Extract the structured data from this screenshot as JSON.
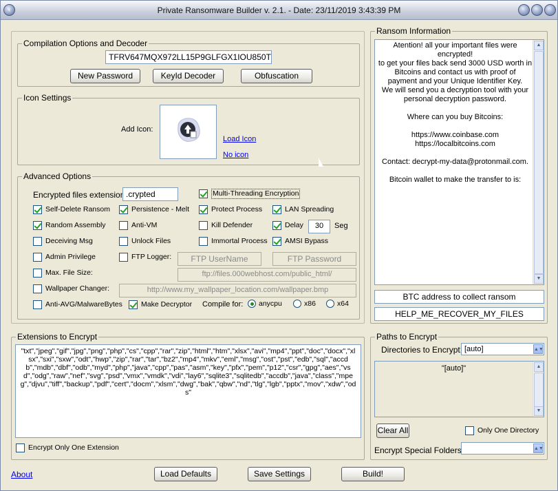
{
  "window": {
    "title": "Private Ransomware Builder v. 2.1. - Date: 23/11/2019 3:43:39 PM"
  },
  "compilation": {
    "title": "Compilation Options and Decoder",
    "password": "TFRV647MQX972LL15P9GLFGX1IOU850T",
    "new_password": "New Password",
    "keyid_decoder": "KeyId Decoder",
    "obfuscation": "Obfuscation"
  },
  "icon_settings": {
    "title": "Icon Settings",
    "add_icon": "Add Icon:",
    "load_icon": "Load Icon",
    "no_icon": "No icon"
  },
  "advanced": {
    "title": "Advanced Options",
    "ext_label": "Encrypted files extension:",
    "ext_value": ".crypted",
    "multithreading": "Multi-Threading Encryption",
    "self_delete": "Self-Delete Ransom",
    "persistence": "Persistence - Melt",
    "protect_process": "Protect Process",
    "lan_spreading": "LAN Spreading",
    "random_assembly": "Random Assembly",
    "anti_vm": "Anti-VM",
    "kill_defender": "Kill Defender",
    "delay": "Delay",
    "delay_value": "30",
    "delay_unit": "Seg",
    "deceiving_msg": "Deceiving Msg",
    "unlock_files": "Unlock Files",
    "immortal_process": "Immortal Process",
    "amsi_bypass": "AMSI Bypass",
    "admin_privilege": "Admin Privilege",
    "ftp_logger": "FTP Logger:",
    "ftp_user": "FTP UserName",
    "ftp_pass": "FTP Password",
    "max_file_size": "Max. File Size:",
    "ftp_url": "ftp://files.000webhost.com/public_html/",
    "wallpaper_changer": "Wallpaper Changer:",
    "wallpaper_url": "http://www.my_wallpaper_location.com/wallpaper.bmp",
    "anti_avg": "Anti-AVG/MalwareBytes",
    "make_decryptor": "Make Decryptor",
    "compile_for": "Compile for:",
    "anycpu": "anycpu",
    "x86": "x86",
    "x64": "x64"
  },
  "ransom": {
    "title": "Ransom Information",
    "lines": [
      "Atention! all your important files were encrypted!",
      "to get your files back send 3000 USD worth in",
      "Bitcoins and contact us with proof of",
      "payment and your Unique Identifier Key.",
      "We will send you a decryption tool with your",
      "personal decryption password.",
      "",
      "Where can you buy Bitcoins:",
      "",
      "https://www.coinbase.com",
      "https://localbitcoins.com",
      "",
      "Contact: decrypt-my-data@protonmail.com.",
      "",
      "Bitcoin wallet to make the transfer to is:"
    ],
    "btc_address": "BTC address to collect ransom",
    "note_name": "HELP_ME_RECOVER_MY_FILES"
  },
  "extensions": {
    "title": "Extensions to Encrypt",
    "list": "\"txt\",\"jpeg\",\"gif\",\"jpg\",\"png\",\"php\",\"cs\",\"cpp\",\"rar\",\"zip\",\"html\",\"htm\",\"xlsx\",\"avi\",\"mp4\",\"ppt\",\"doc\",\"docx\",\"xlsx\",\"sxi\",\"sxw\",\"odt\",\"hwp\",\"zip\",\"rar\",\"tar\",\"bz2\",\"mp4\",\"mkv\",\"eml\",\"msg\",\"ost\",\"pst\",\"edb\",\"sql\",\"accdb\",\"mdb\",\"dbf\",\"odb\",\"myd\",\"php\",\"java\",\"cpp\",\"pas\",\"asm\",\"key\",\"pfx\",\"pem\",\"p12\",\"csr\",\"gpg\",\"aes\",\"vsd\",\"odg\",\"raw\",\"nef\",\"svg\",\"psd\",\"vmx\",\"vmdk\",\"vdi\",\"lay6\",\"sqlite3\",\"sqlitedb\",\"accdb\",\"java\",\"class\",\"mpeg\",\"djvu\",\"tiff\",\"backup\",\"pdf\",\"cert\",\"docm\",\"xlsm\",\"dwg\",\"bak\",\"qbw\",\"nd\",\"tlg\",\"lgb\",\"pptx\",\"mov\",\"xdw\",\"ods\"",
    "only_one": "Encrypt Only One Extension"
  },
  "paths": {
    "title": "Paths to Encrypt",
    "dirs_label": "Directories to Encrypt:",
    "dirs_value": "[auto]",
    "list_item": "\"[auto]\"",
    "clear_all": "Clear All",
    "only_one_dir": "Only One Directory",
    "special_label": "Encrypt Special Folders:",
    "special_value": ""
  },
  "footer": {
    "about": "About",
    "load_defaults": "Load Defaults",
    "save_settings": "Save Settings",
    "build": "Build!"
  },
  "icons": {
    "arrow_up": "▲",
    "arrow_down": "▼",
    "dropdown": "▲▼"
  }
}
